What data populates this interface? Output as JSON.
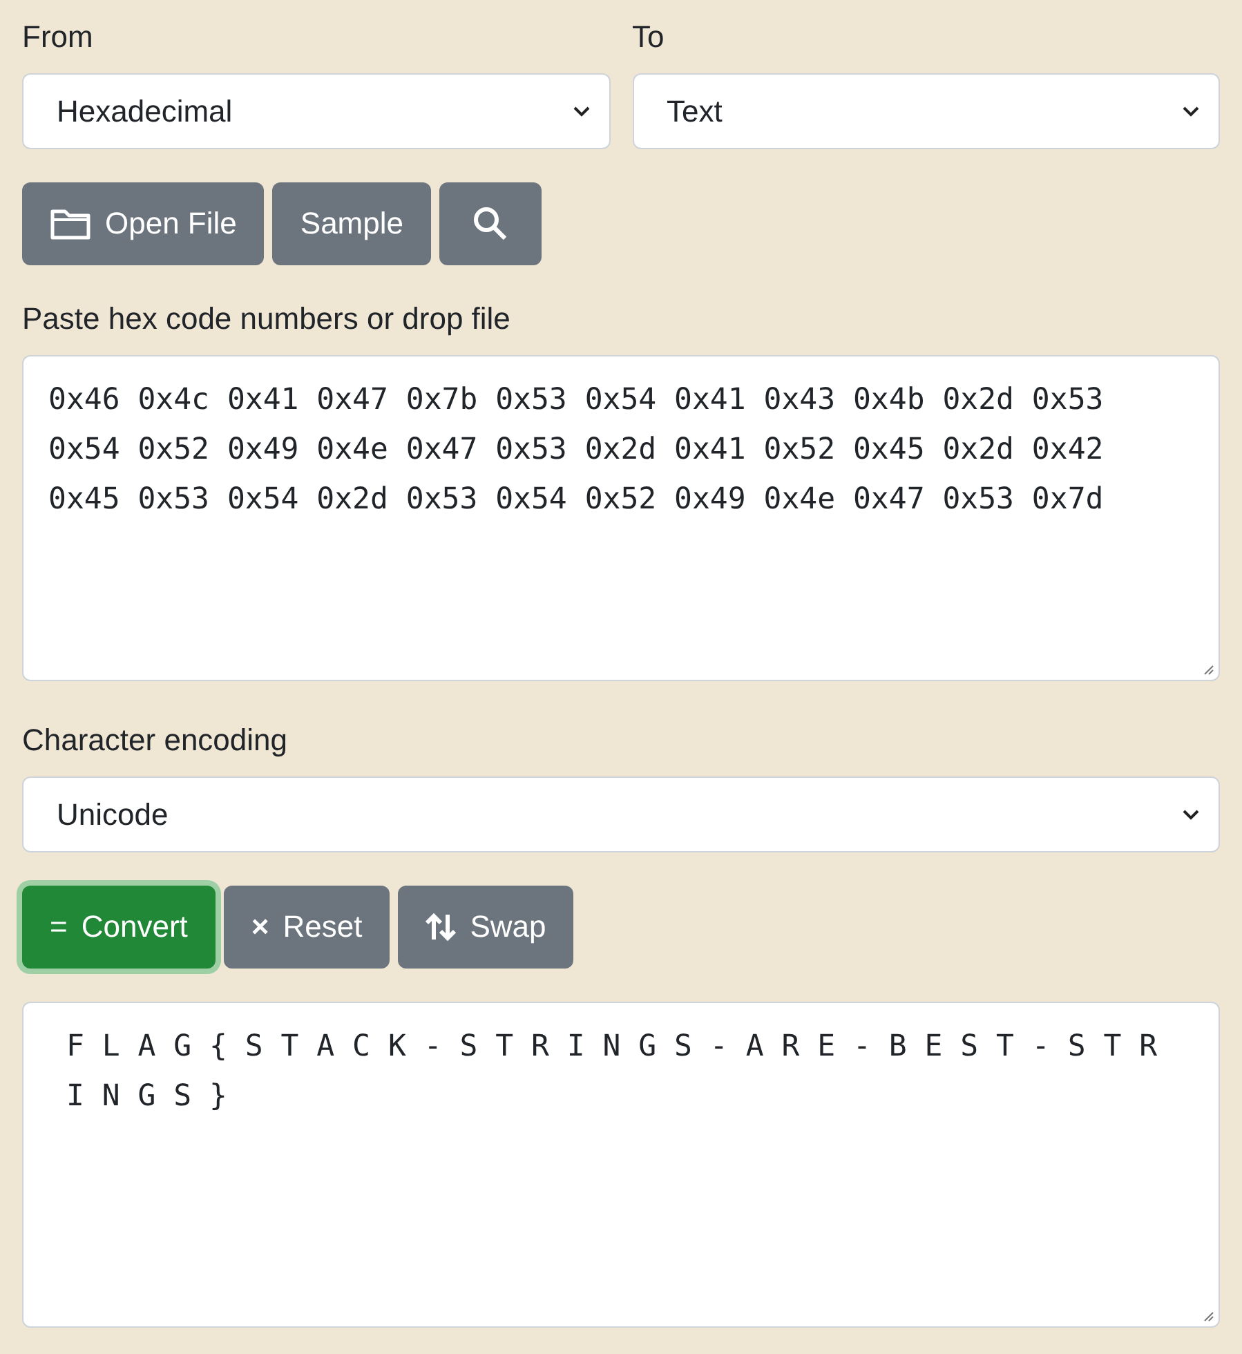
{
  "from": {
    "label": "From",
    "value": "Hexadecimal"
  },
  "to": {
    "label": "To",
    "value": "Text"
  },
  "toolbar": [
    {
      "kind": "open",
      "label": "Open File"
    },
    {
      "kind": "sample",
      "label": "Sample"
    },
    {
      "kind": "search"
    }
  ],
  "input": {
    "label": "Paste hex code numbers or drop file",
    "lines": [
      "0x46 0x4c 0x41 0x47 0x7b 0x53 0x54 0x41 0x43 0x4b 0x2d 0x53",
      "0x54 0x52 0x49 0x4e 0x47 0x53 0x2d 0x41 0x52 0x45 0x2d 0x42",
      "0x45 0x53 0x54 0x2d 0x53 0x54 0x52 0x49 0x4e 0x47 0x53 0x7d"
    ]
  },
  "encoding": {
    "label": "Character encoding",
    "value": "Unicode"
  },
  "actions": [
    {
      "kind": "convert",
      "icon": "=",
      "label": "Convert",
      "focused": true
    },
    {
      "kind": "reset",
      "icon": "×",
      "label": "Reset",
      "focused": false
    },
    {
      "kind": "swap",
      "label": "Swap",
      "focused": false
    }
  ],
  "output": {
    "lines": [
      " F L A G { S T A C K - S T R I N G S - A R E - B E S T - S T R",
      " I N G S }"
    ]
  }
}
